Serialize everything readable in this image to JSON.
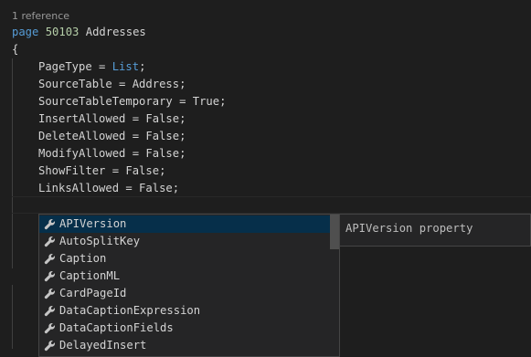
{
  "codelens": "1 reference",
  "code": {
    "page_keyword": "page",
    "page_id": "50103",
    "page_name": "Addresses",
    "open_brace": "{",
    "props": [
      {
        "name": "PageType = ",
        "value": "List",
        "end": ";"
      },
      {
        "name": "SourceTable = Address;",
        "value": "",
        "end": ""
      },
      {
        "name": "SourceTableTemporary = True;",
        "value": "",
        "end": ""
      },
      {
        "name": "InsertAllowed = False;",
        "value": "",
        "end": ""
      },
      {
        "name": "DeleteAllowed = False;",
        "value": "",
        "end": ""
      },
      {
        "name": "ModifyAllowed = False;",
        "value": "",
        "end": ""
      },
      {
        "name": "ShowFilter = False;",
        "value": "",
        "end": ""
      },
      {
        "name": "LinksAllowed = False;",
        "value": "",
        "end": ""
      }
    ]
  },
  "suggest": {
    "icon": "wrench-icon",
    "selected_index": 0,
    "items": [
      "APIVersion",
      "AutoSplitKey",
      "Caption",
      "CaptionML",
      "CardPageId",
      "DataCaptionExpression",
      "DataCaptionFields",
      "DelayedInsert"
    ]
  },
  "details": "APIVersion property",
  "colors": {
    "keyword": "#569cd6",
    "number": "#b5cea8",
    "text": "#d4d4d4",
    "background": "#1e1e1e",
    "selection": "#062f4a",
    "wrench": "#c5c5c5"
  }
}
